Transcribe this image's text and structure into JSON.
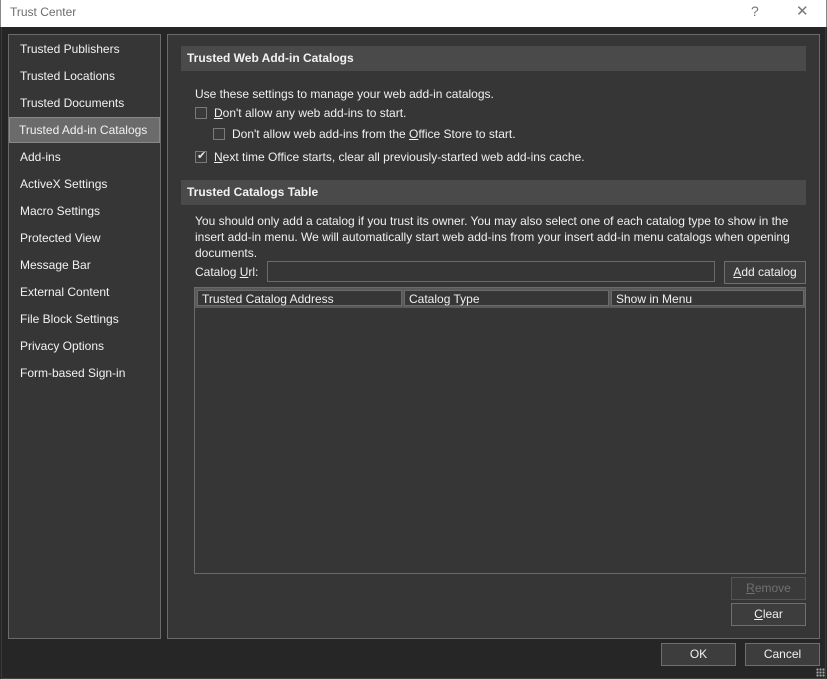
{
  "window": {
    "title": "Trust Center",
    "help_glyph": "?",
    "close_glyph": "✕"
  },
  "sidebar": {
    "selected": "Trusted Add-in Catalogs",
    "items": [
      {
        "label": "Trusted Publishers"
      },
      {
        "label": "Trusted Locations"
      },
      {
        "label": "Trusted Documents"
      },
      {
        "label": "Trusted Add-in Catalogs"
      },
      {
        "label": "Add-ins"
      },
      {
        "label": "ActiveX Settings"
      },
      {
        "label": "Macro Settings"
      },
      {
        "label": "Protected View"
      },
      {
        "label": "Message Bar"
      },
      {
        "label": "External Content"
      },
      {
        "label": "File Block Settings"
      },
      {
        "label": "Privacy Options"
      },
      {
        "label": "Form-based Sign-in"
      }
    ]
  },
  "web_catalogs": {
    "header": "Trusted Web Add-in Catalogs",
    "intro": "Use these settings to manage your web add-in catalogs.",
    "options": [
      {
        "accel": "D",
        "rest": "on't allow any web add-ins to start.",
        "pre": "",
        "checked": false
      },
      {
        "pre": "Don't allow web add-ins from the ",
        "accel": "O",
        "rest": "ffice Store to start.",
        "checked": false
      },
      {
        "accel": "N",
        "rest": "ext time Office starts, clear all previously-started web add-ins cache.",
        "pre": "",
        "checked": true
      }
    ]
  },
  "catalogs_table": {
    "header": "Trusted Catalogs Table",
    "description": "You should only add a catalog if you trust its owner. You may also select one of each catalog type to show in the insert add-in menu. We will automatically start web add-ins from your insert add-in menu catalogs when opening documents.",
    "url_label_pre": "Catalog ",
    "url_label_accel": "U",
    "url_label_rest": "rl:",
    "url_value": "",
    "add_button": {
      "accel": "A",
      "rest": "dd catalog"
    },
    "columns": [
      "Trusted Catalog Address",
      "Catalog Type",
      "Show in Menu"
    ],
    "rows": [],
    "remove_button": {
      "accel": "R",
      "rest": "emove",
      "enabled": false
    },
    "clear_button": {
      "accel": "C",
      "rest": "lear",
      "enabled": true
    }
  },
  "footer": {
    "ok_label": "OK",
    "cancel_label": "Cancel"
  }
}
